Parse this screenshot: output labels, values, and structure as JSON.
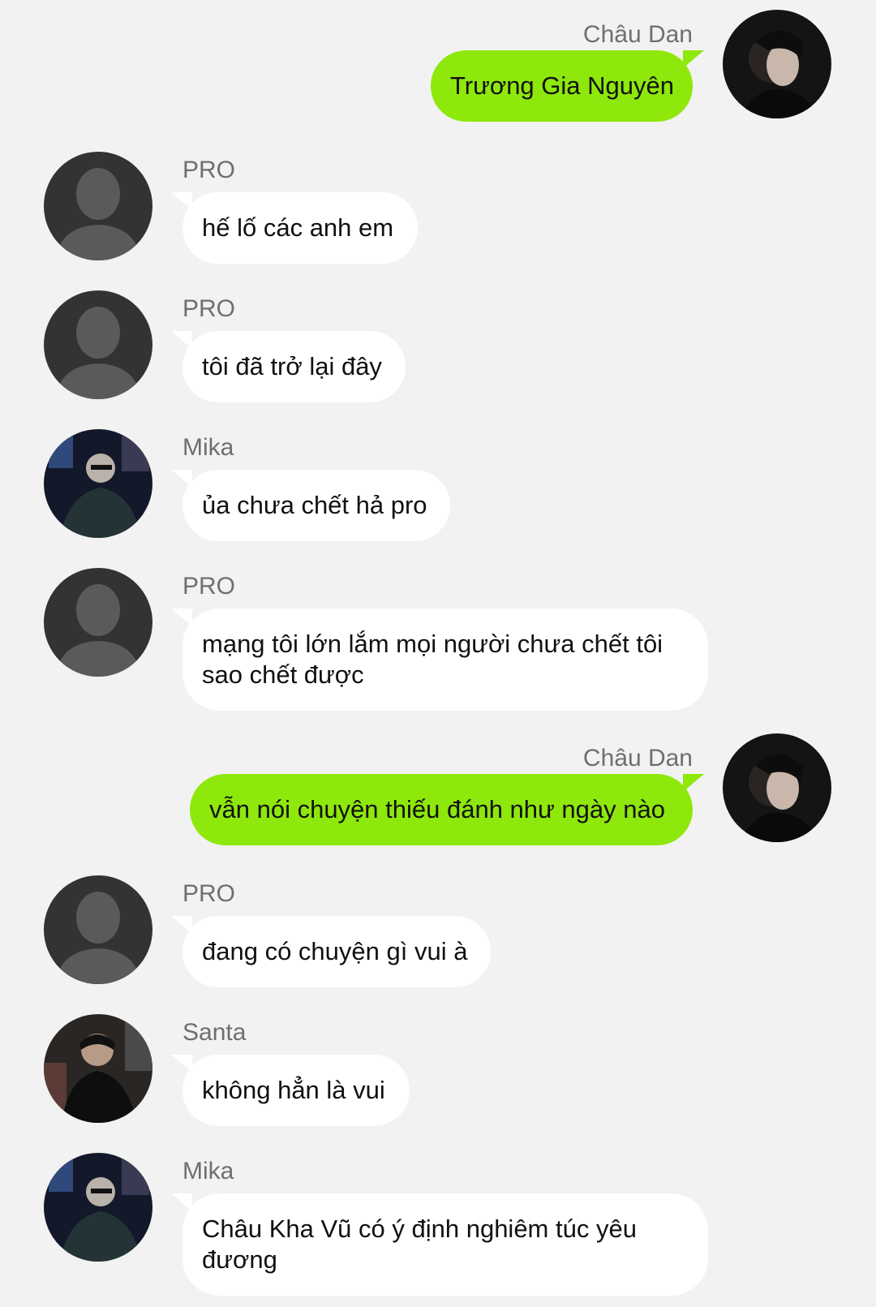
{
  "messages": [
    {
      "side": "out",
      "sender": "Châu Dan",
      "text": "Trương Gia Nguyên",
      "avatar": "chau-dan"
    },
    {
      "side": "in",
      "sender": "PRO",
      "text": "hế lố các anh em",
      "avatar": "default"
    },
    {
      "side": "in",
      "sender": "PRO",
      "text": "tôi đã trở lại đây",
      "avatar": "default"
    },
    {
      "side": "in",
      "sender": "Mika",
      "text": "ủa chưa chết hả pro",
      "avatar": "mika"
    },
    {
      "side": "in",
      "sender": "PRO",
      "text": "mạng tôi lớn lắm mọi người chưa chết tôi sao chết được",
      "avatar": "default"
    },
    {
      "side": "out",
      "sender": "Châu Dan",
      "text": "vẫn nói chuyện thiếu đánh như ngày nào",
      "avatar": "chau-dan"
    },
    {
      "side": "in",
      "sender": "PRO",
      "text": "đang có chuyện gì vui à",
      "avatar": "default"
    },
    {
      "side": "in",
      "sender": "Santa",
      "text": "không hẳn là vui",
      "avatar": "santa"
    },
    {
      "side": "in",
      "sender": "Mika",
      "text": "Châu Kha Vũ có ý định nghiêm túc yêu đương",
      "avatar": "mika"
    }
  ],
  "colors": {
    "background": "#f2f2f2",
    "incoming_bubble": "#ffffff",
    "outgoing_bubble": "#8ee80b",
    "sender_name": "#6f6f6f",
    "message_text": "#111111"
  }
}
